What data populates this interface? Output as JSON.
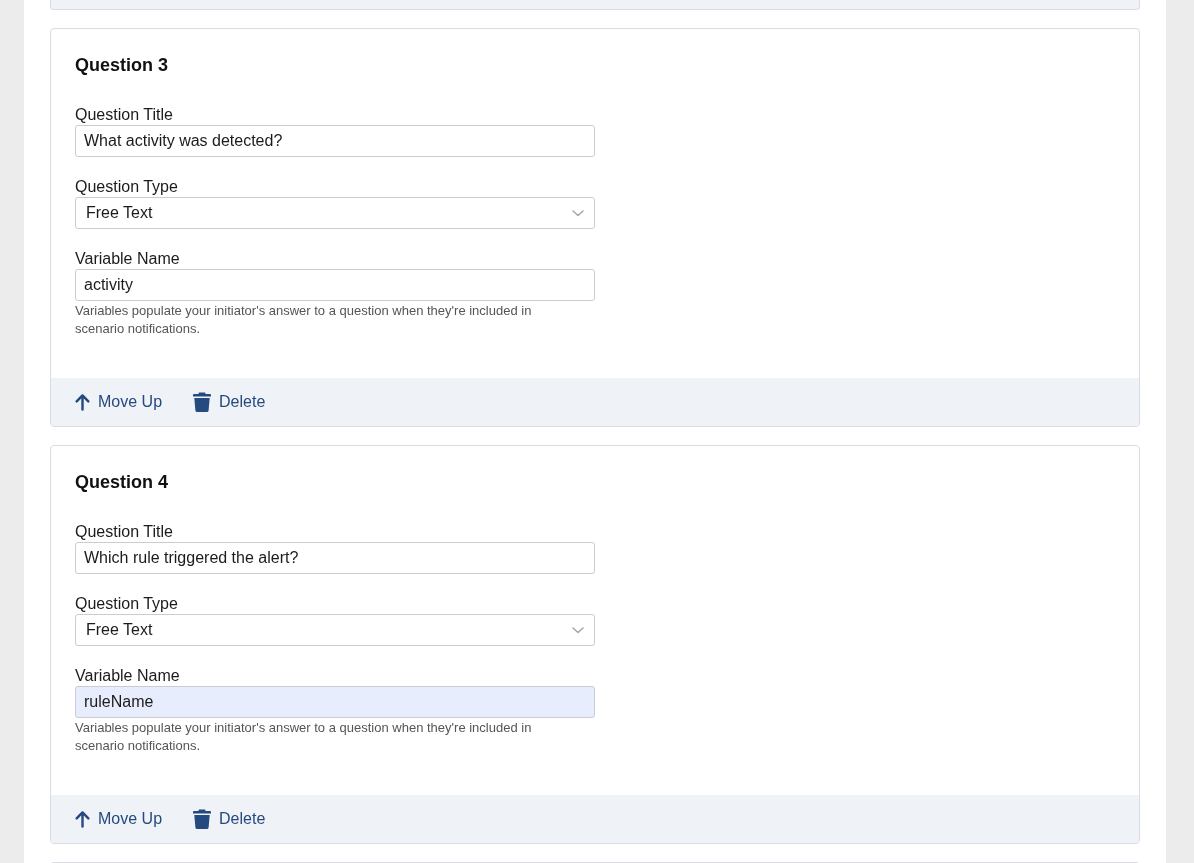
{
  "questions": [
    {
      "heading": "Question 3",
      "fields": [
        {
          "kind": "text",
          "label": "Question Title",
          "value": "What activity was detected?",
          "highlighted": false
        },
        {
          "kind": "select",
          "label": "Question Type",
          "value": "Free Text"
        },
        {
          "kind": "text",
          "label": "Variable Name",
          "value": "activity",
          "highlighted": false,
          "help": "Variables populate your initiator's answer to a question when they're included in scenario notifications."
        }
      ],
      "actions": [
        {
          "kind": "move-up",
          "label": "Move Up"
        },
        {
          "kind": "delete",
          "label": "Delete"
        }
      ]
    },
    {
      "heading": "Question 4",
      "fields": [
        {
          "kind": "text",
          "label": "Question Title",
          "value": "Which rule triggered the alert?",
          "highlighted": false
        },
        {
          "kind": "select",
          "label": "Question Type",
          "value": "Free Text"
        },
        {
          "kind": "text",
          "label": "Variable Name",
          "value": "ruleName",
          "highlighted": true,
          "help": "Variables populate your initiator's answer to a question when they're included in scenario notifications."
        }
      ],
      "actions": [
        {
          "kind": "move-up",
          "label": "Move Up"
        },
        {
          "kind": "delete",
          "label": "Delete"
        }
      ]
    }
  ]
}
